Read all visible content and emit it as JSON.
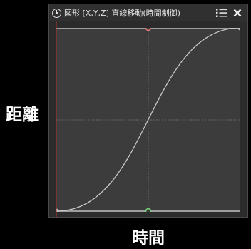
{
  "window": {
    "title": "図形 [X,Y,Z] 直線移動(時間制御)",
    "title_icon": "clock-icon",
    "menu_icon": "list-menu-icon",
    "close_icon": "close-icon"
  },
  "axes": {
    "y_label": "距離",
    "x_label": "時間"
  },
  "colors": {
    "background": "#000000",
    "panel": "#2b2b2b",
    "titlebar": "#303030",
    "curve": "#c8c8c8",
    "left_edge_line": "#b03030",
    "guide_line": "#5a5a5a",
    "top_handle": "#e07a7a",
    "bottom_handle": "#7ad67a",
    "anchor": "#c0c0c0"
  }
}
